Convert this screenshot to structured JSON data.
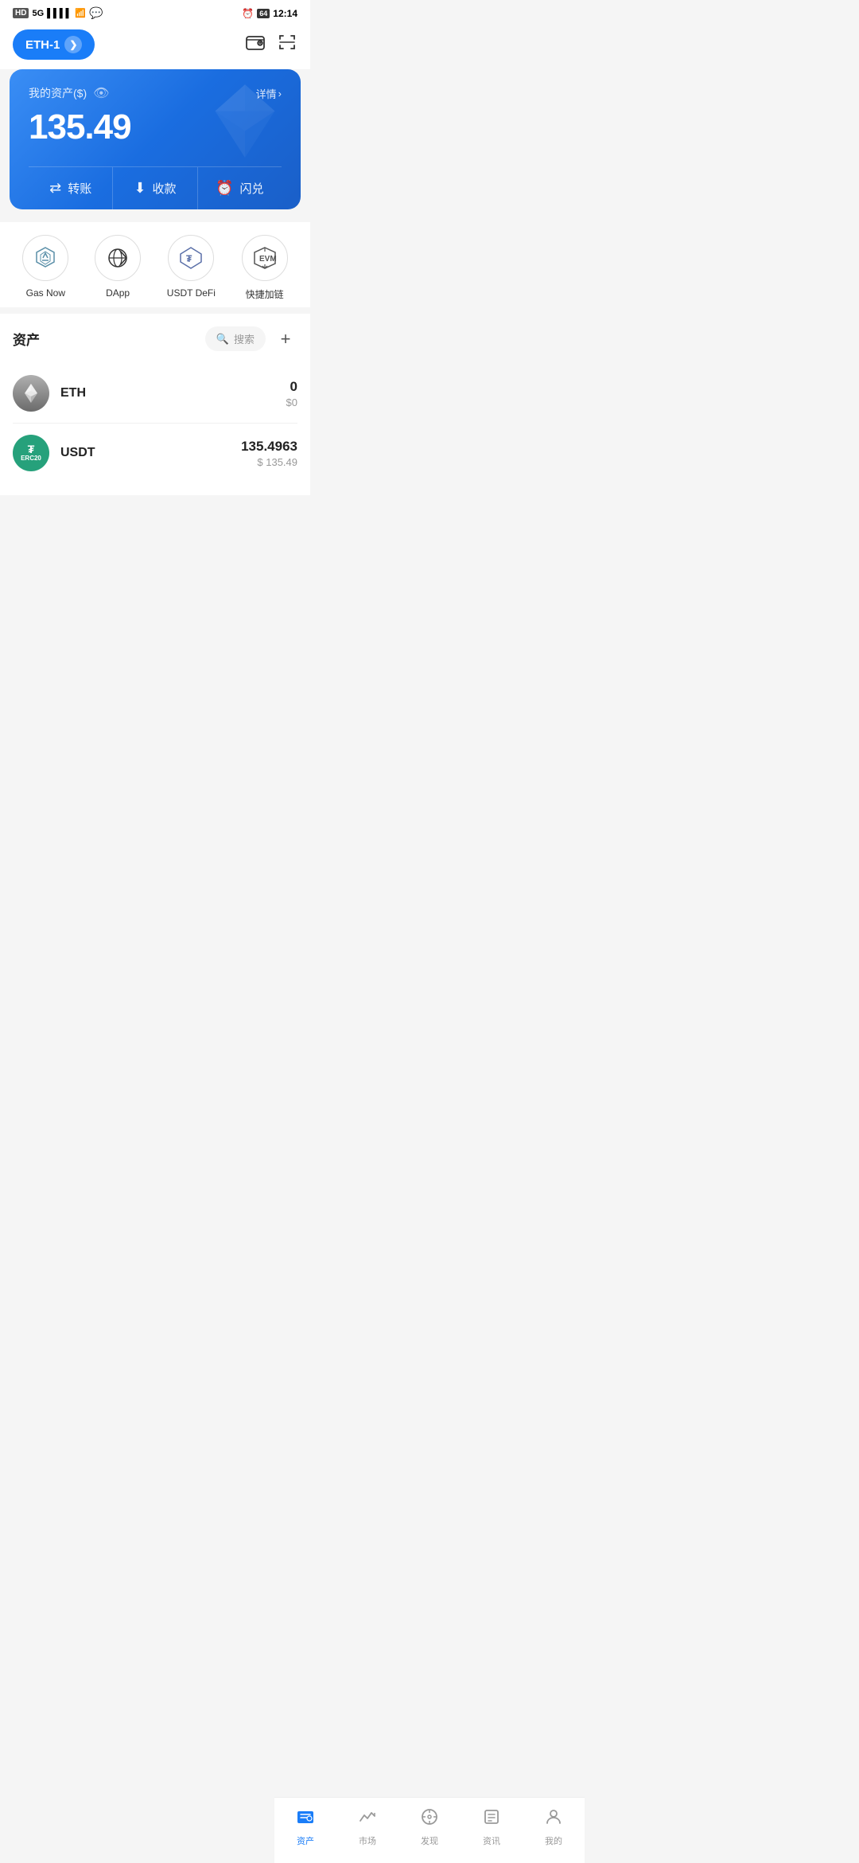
{
  "statusBar": {
    "left": "HD 5G",
    "time": "12:14",
    "batteryLevel": "64"
  },
  "header": {
    "networkLabel": "ETH-1",
    "walletIcon": "wallet-icon",
    "scanIcon": "scan-icon"
  },
  "balanceCard": {
    "assetLabel": "我的资产($)",
    "detailLabel": "详情",
    "amount": "135.49",
    "actions": [
      {
        "icon": "transfer-icon",
        "label": "转账"
      },
      {
        "icon": "receive-icon",
        "label": "收款"
      },
      {
        "icon": "flash-icon",
        "label": "闪兑"
      }
    ]
  },
  "quickAccess": [
    {
      "label": "Gas Now",
      "iconName": "gas-now-icon"
    },
    {
      "label": "DApp",
      "iconName": "dapp-icon"
    },
    {
      "label": "USDT DeFi",
      "iconName": "usdt-defi-icon"
    },
    {
      "label": "快捷加链",
      "iconName": "quick-chain-icon"
    }
  ],
  "assets": {
    "title": "资产",
    "searchPlaceholder": "搜索",
    "addLabel": "+",
    "items": [
      {
        "symbol": "ETH",
        "name": "ETH",
        "balance": "0",
        "usdValue": "$0"
      },
      {
        "symbol": "USDT",
        "name": "USDT",
        "balance": "135.4963",
        "usdValue": "$ 135.49"
      }
    ]
  },
  "bottomNav": [
    {
      "label": "资产",
      "icon": "assets-nav-icon",
      "active": true
    },
    {
      "label": "市场",
      "icon": "market-nav-icon",
      "active": false
    },
    {
      "label": "发现",
      "icon": "discover-nav-icon",
      "active": false
    },
    {
      "label": "资讯",
      "icon": "news-nav-icon",
      "active": false
    },
    {
      "label": "我的",
      "icon": "profile-nav-icon",
      "active": false
    }
  ]
}
